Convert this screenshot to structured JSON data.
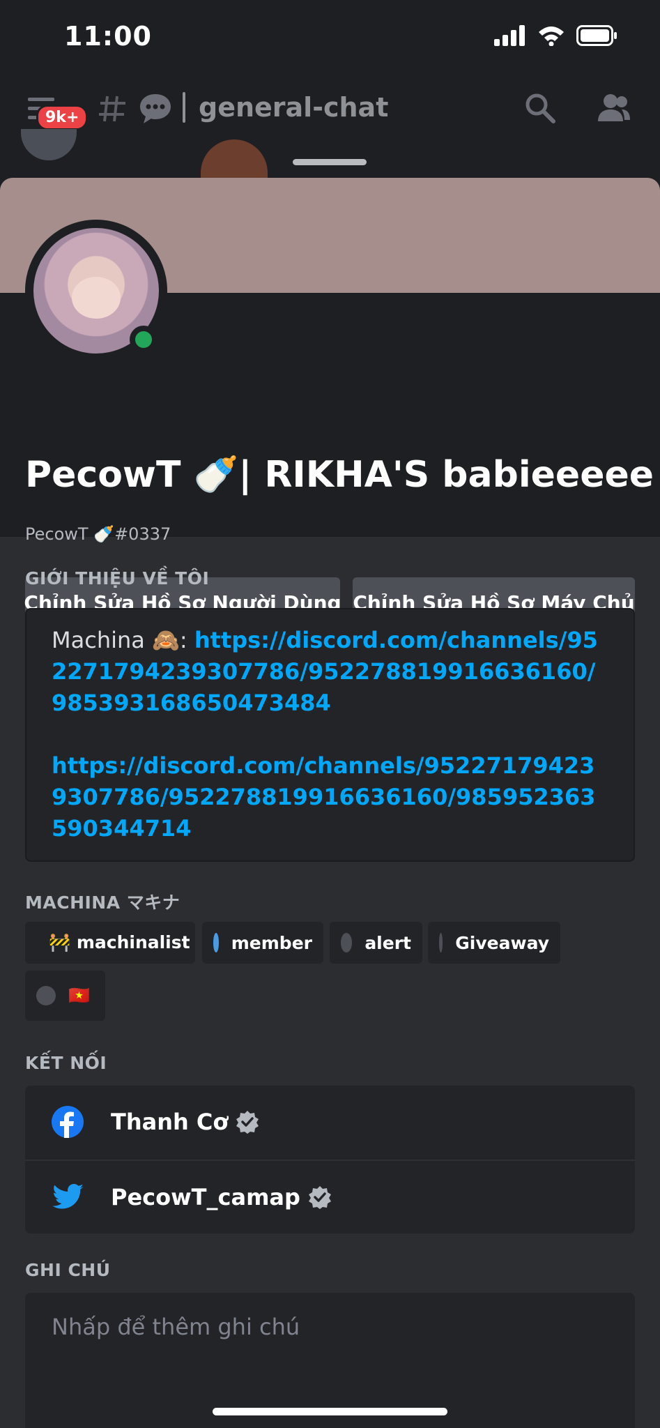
{
  "status": {
    "time": "11:00"
  },
  "header": {
    "badge": "9k+",
    "channel": "general-chat"
  },
  "profile": {
    "display_name": "PecowT 🍼|  RIKHA'S babieeeee",
    "tag": "PecowT 🍼#0337",
    "edit_user_profile": "Chỉnh Sửa Hồ Sơ Người Dùng",
    "edit_server_profile": "Chỉnh Sửa Hồ Sơ Máy Chủ"
  },
  "about": {
    "title": "GIỚI THIỆU VỀ TÔI",
    "prefix": "Machina 🙈: ",
    "link1": "https://discord.com/channels/952271794239307786/952278819916636160/985393168650473484",
    "link2": "https://discord.com/channels/952271794239307786/952278819916636160/985952363590344714"
  },
  "roles": {
    "title": "MACHINA マキナ",
    "items": [
      {
        "label": "🚧 machinalist",
        "color": "#f0e4d0"
      },
      {
        "label": "member",
        "color": "#4a9be3"
      },
      {
        "label": "alert",
        "color": "#4e5058"
      },
      {
        "label": "Giveaway",
        "color": "#4e5058"
      },
      {
        "label": "🇻🇳",
        "color": "#4e5058"
      }
    ]
  },
  "connections": {
    "title": "KẾT NỐI",
    "items": [
      {
        "service": "facebook",
        "name": "Thanh Cơ"
      },
      {
        "service": "twitter",
        "name": "PecowT_camap"
      }
    ]
  },
  "note": {
    "title": "GHI CHÚ",
    "placeholder": "Nhấp để thêm ghi chú"
  },
  "colors": {
    "online": "#23a55a",
    "link": "#00a8fc",
    "banner": "#a58e8b"
  }
}
